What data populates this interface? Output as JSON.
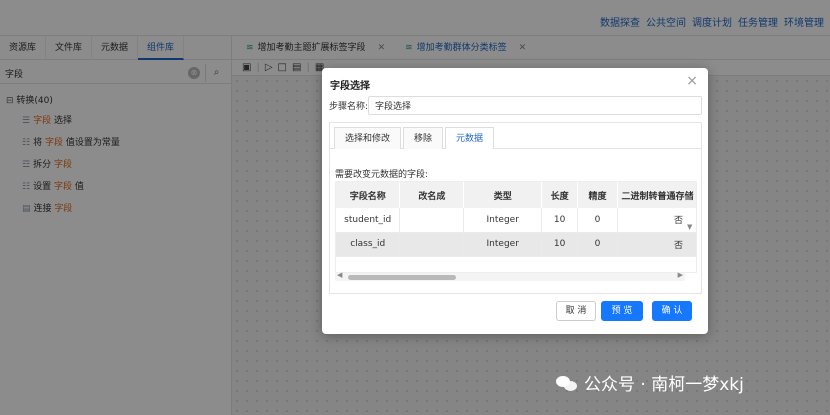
{
  "topnav": [
    "数据探查",
    "公共空间",
    "调度计划",
    "任务管理",
    "环境管理"
  ],
  "left_tabs": [
    "资源库",
    "文件库",
    "元数据",
    "组件库"
  ],
  "left_active_tab": 3,
  "search": {
    "value": "字段",
    "clear": "⊗",
    "icon": "search-icon"
  },
  "tree": {
    "root": "转换(40)",
    "items": [
      {
        "prefix": "",
        "hl": "字段",
        "suffix": " 选择",
        "icon": "list-icon"
      },
      {
        "prefix": "将 ",
        "hl": "字段",
        "suffix": " 值设置为常量",
        "icon": "const-icon"
      },
      {
        "prefix": "拆分 ",
        "hl": "字段",
        "suffix": "",
        "icon": "split-icon"
      },
      {
        "prefix": "设置 ",
        "hl": "字段",
        "suffix": " 值",
        "icon": "set-icon"
      },
      {
        "prefix": "连接 ",
        "hl": "字段",
        "suffix": "",
        "icon": "join-icon"
      }
    ]
  },
  "work_tabs": [
    {
      "label": "增加考勤主题扩展标签字段",
      "close": "✕"
    },
    {
      "label": "增加考勤群体分类标签",
      "close": "✕"
    }
  ],
  "dialog": {
    "title": "字段选择",
    "close": "×",
    "step_label": "步骤名称:",
    "step_value": "字段选择",
    "tabs": [
      "选择和修改",
      "移除",
      "元数据"
    ],
    "active_tab": 2,
    "need_label": "需要改变元数据的字段:",
    "columns": [
      "字段名称",
      "改名成",
      "类型",
      "长度",
      "精度",
      "二进制转普通存储"
    ],
    "rows": [
      [
        "student_id",
        "",
        "Integer",
        "10",
        "0",
        "否"
      ],
      [
        "class_id",
        "",
        "Integer",
        "10",
        "0",
        "否"
      ]
    ],
    "buttons": {
      "cancel": "取 消",
      "preview": "预 览",
      "ok": "确 认"
    }
  },
  "watermark": "公众号 · 南柯一梦xkj",
  "colors": {
    "accent": "#1677ff",
    "link": "#1e66c8",
    "highlight": "#e26a1a"
  }
}
